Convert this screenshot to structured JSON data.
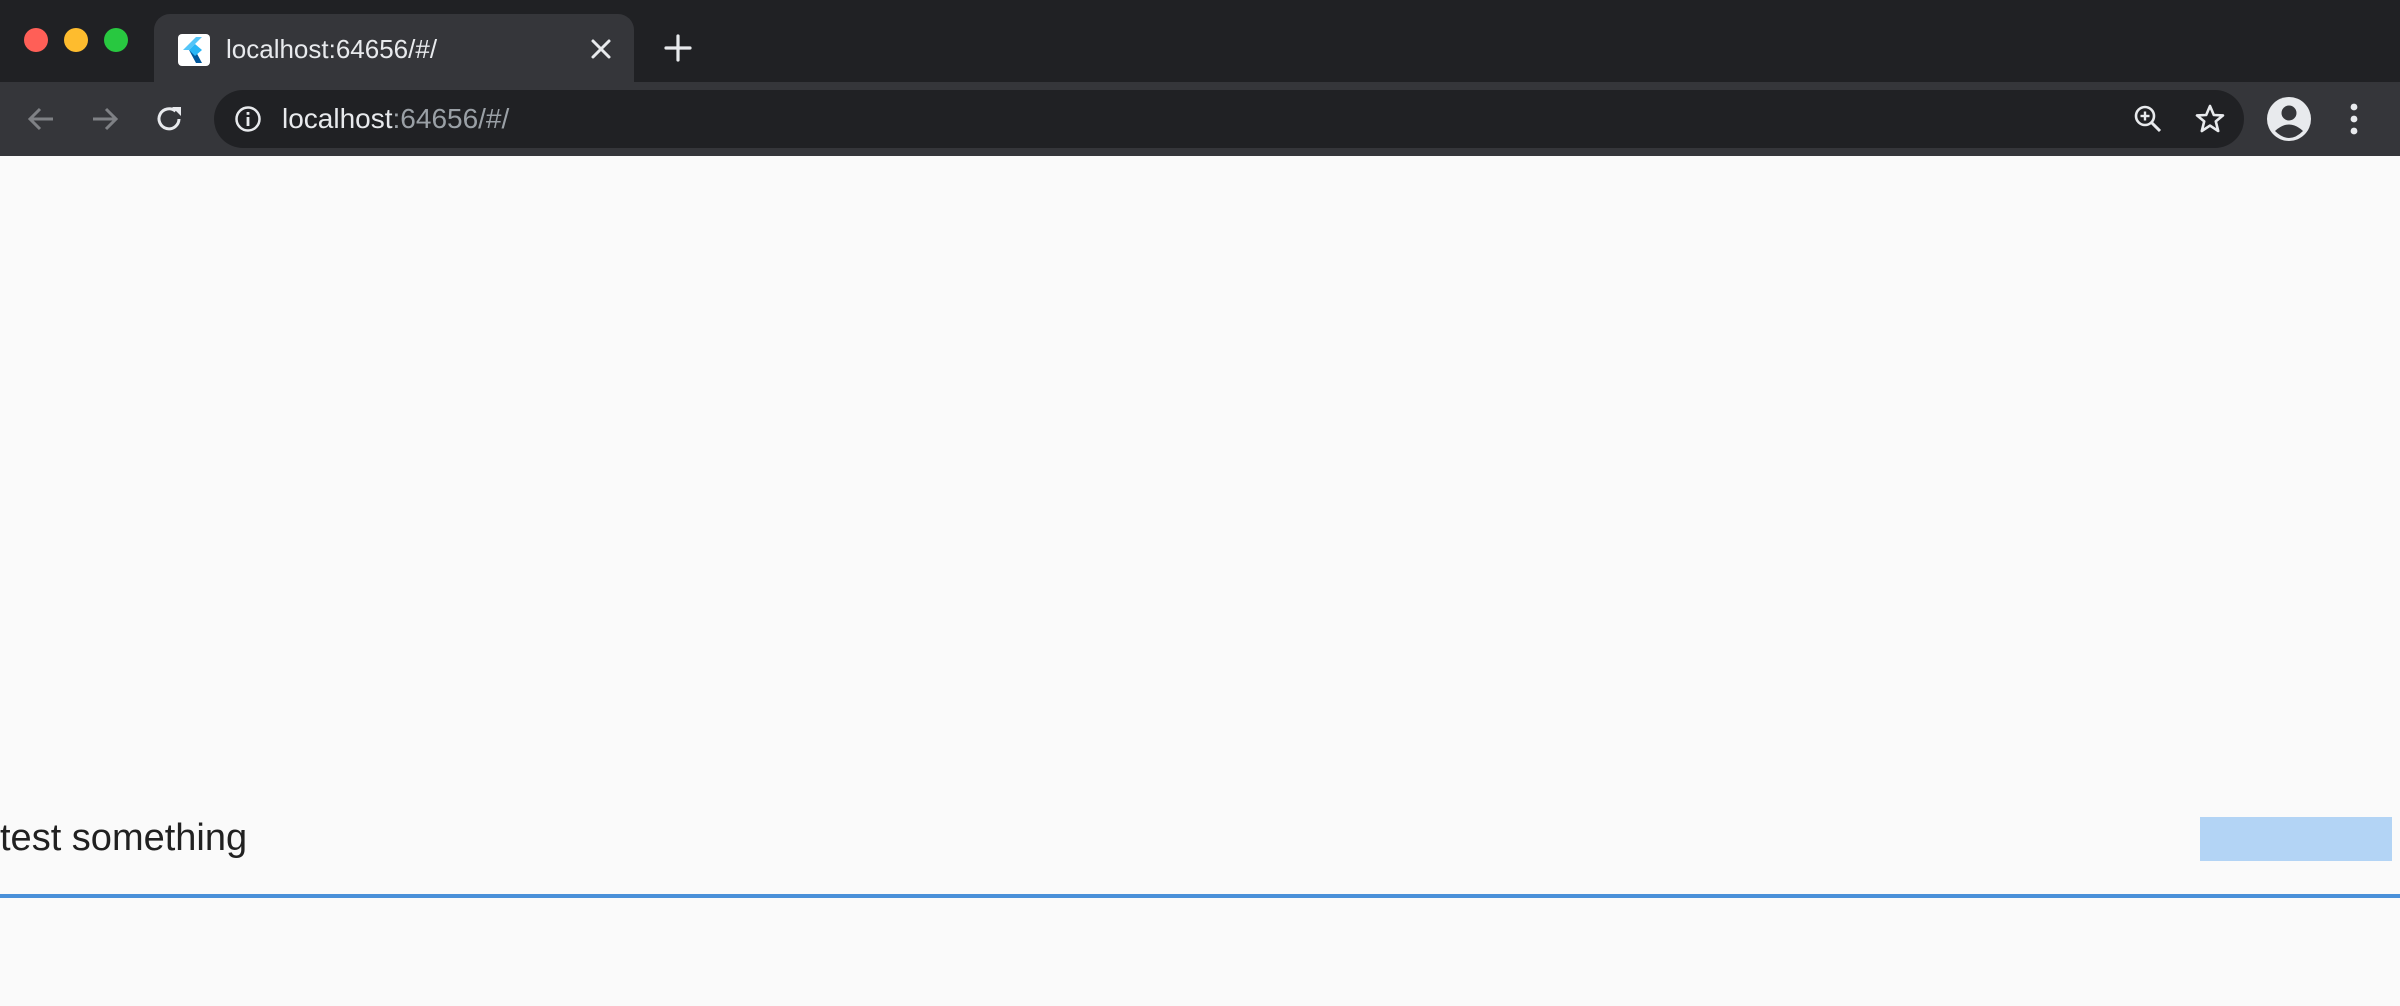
{
  "browser": {
    "tab": {
      "title": "localhost:64656/#/",
      "favicon": "flutter-icon"
    },
    "toolbar": {
      "back_icon": "arrow-left-icon",
      "forward_icon": "arrow-right-icon",
      "reload_icon": "reload-icon"
    },
    "address_bar": {
      "host": "localhost",
      "rest": ":64656/#/",
      "site_info_icon": "info-icon",
      "zoom_icon": "zoom-icon",
      "bookmark_icon": "star-icon"
    },
    "profile_icon": "avatar-icon",
    "menu_icon": "kebab-menu-icon"
  },
  "page": {
    "text_field": {
      "label": "test something"
    }
  },
  "colors": {
    "chrome_bg": "#202124",
    "toolbar_bg": "#35363a",
    "page_bg": "#fafafa",
    "selection": "#b3d4f5",
    "underline": "#4a90d9"
  }
}
